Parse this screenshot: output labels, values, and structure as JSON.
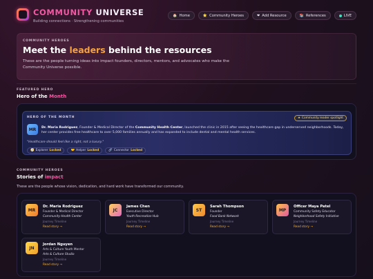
{
  "header": {
    "brand_first": "COMMUNITY",
    "brand_second": "UNIVERSE",
    "tagline": "Building connections · Strengthening communities",
    "nav": [
      {
        "icon": "home-icon",
        "glyph": "🏠",
        "label": "Home"
      },
      {
        "icon": "star-icon",
        "glyph": "⭐",
        "label": "Community Heroes"
      },
      {
        "icon": "heart-icon",
        "glyph": "❤",
        "label": "Add Resource"
      },
      {
        "icon": "books-icon",
        "glyph": "📚",
        "label": "References"
      },
      {
        "icon": "live-dot-icon",
        "glyph": "",
        "label": "LIVE"
      }
    ]
  },
  "intro": {
    "kicker": "COMMUNITY HEROES",
    "title_before": "Meet the ",
    "title_highlight": "leaders",
    "title_after": " behind the resources",
    "description": "These are the people turning ideas into impact founders, directors, mentors, and advocates who make the Community Universe possible."
  },
  "featured": {
    "kicker": "FEATURED HERO",
    "title_before": "Hero of the ",
    "title_highlight": "Month",
    "card_kicker": "HERO OF THE MONTH",
    "spotlight": "Community leader spotlight",
    "avatar": "MR",
    "name": "Dr. Maria Rodriguez",
    "text_mid": ", Founder & Medical Director of the ",
    "org": "Community Health Center",
    "text_end": ", launched the clinic in 2015 after seeing the healthcare gap in underserved neighborhoods. Today, her center provides free healthcare to over 5,000 families annually and has expanded to include dental and mental health services.",
    "quote": "\"Healthcare should feel like a right, not a luxury.\"",
    "badges": [
      {
        "icon": "explorer-icon",
        "glyph": "🧭",
        "label": "Explorer",
        "status": "Locked"
      },
      {
        "icon": "helper-icon",
        "glyph": "🤝",
        "label": "Helper",
        "status": "Locked"
      },
      {
        "icon": "connector-icon",
        "glyph": "🔗",
        "label": "Connector",
        "status": "Locked"
      }
    ]
  },
  "stories": {
    "kicker": "COMMUNITY HEROES",
    "title_before": "Stories of ",
    "title_highlight": "impact",
    "subtitle": "These are the people whose vision, dedication, and hard work have transformed our community.",
    "cards": [
      {
        "initials": "MR",
        "name": "Dr. Maria Rodriguez",
        "role": "Founder & Medical Director",
        "org": "Community Health Center",
        "timeline": "Journey Timeline",
        "cta": "Read story →",
        "color": "#f2a93b"
      },
      {
        "initials": "JC",
        "name": "James Chen",
        "role": "Executive Director",
        "org": "Youth Recreation Hub",
        "timeline": "Journey Timeline",
        "cta": "Read story →",
        "color": "#f2a93b"
      },
      {
        "initials": "ST",
        "name": "Sarah Thompson",
        "role": "Founder",
        "org": "Food Bank Network",
        "timeline": "Journey Timeline",
        "cta": "Read story →",
        "color": "#f2a93b"
      },
      {
        "initials": "MP",
        "name": "Officer Maya Patel",
        "role": "Community Safety Educator",
        "org": "Neighborhood Safety Initiative",
        "timeline": "Journey Timeline",
        "cta": "Read story →",
        "color": "#f2a93b"
      },
      {
        "initials": "JN",
        "name": "Jordan Nguyen",
        "role": "Arts & Culture Youth Mentor",
        "org": "Arts & Culture Studio",
        "timeline": "Journey Timeline",
        "cta": "Read story →",
        "color": "#f2a93b"
      }
    ]
  }
}
